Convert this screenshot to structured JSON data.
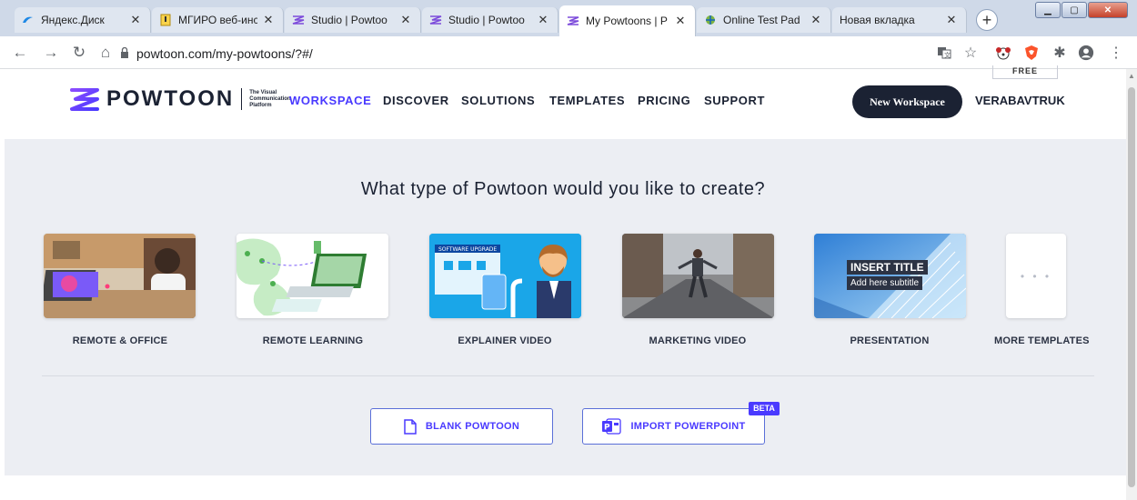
{
  "browser": {
    "tabs": [
      {
        "title": "Яндекс.Диск",
        "icon": "yandex-disk-icon"
      },
      {
        "title": "МГИРО веб-инс",
        "icon": "document-icon"
      },
      {
        "title": "Studio | Powtoo",
        "icon": "powtoon-icon"
      },
      {
        "title": "Studio | Powtoo",
        "icon": "powtoon-icon"
      },
      {
        "title": "My Powtoons | P",
        "icon": "powtoon-icon"
      },
      {
        "title": "Online Test Pad",
        "icon": "testpad-icon"
      },
      {
        "title": "Новая вкладка",
        "icon": ""
      }
    ],
    "active_tab": 4,
    "url": "powtoon.com/my-powtoons/?#/"
  },
  "header": {
    "logo_text": "POWTOON",
    "tagline": "The Visual Communication Platform",
    "nav": [
      "WORKSPACE",
      "DISCOVER",
      "SOLUTIONS",
      "TEMPLATES",
      "PRICING",
      "SUPPORT"
    ],
    "plan_badge": "FREE",
    "new_workspace_label": "New Workspace",
    "username": "VERABAVTRUK"
  },
  "main": {
    "question": "What type of Powtoon would you like to create?",
    "types": [
      {
        "label": "REMOTE & OFFICE"
      },
      {
        "label": "REMOTE LEARNING"
      },
      {
        "label": "EXPLAINER VIDEO"
      },
      {
        "label": "MARKETING VIDEO"
      },
      {
        "label": "PRESENTATION",
        "thumb_title": "INSERT TITLE",
        "thumb_subtitle": "Add here subtitle"
      },
      {
        "label": "MORE TEMPLATES",
        "thumb_text": "• • •"
      }
    ],
    "explainer_thumb_text": "SOFTWARE UPGRADE",
    "blank_button": "BLANK POWTOON",
    "import_button": "IMPORT POWERPOINT",
    "beta_badge": "BETA"
  },
  "colors": {
    "accent": "#4a3aff",
    "dark": "#1b2233",
    "panel": "#eceef3"
  }
}
